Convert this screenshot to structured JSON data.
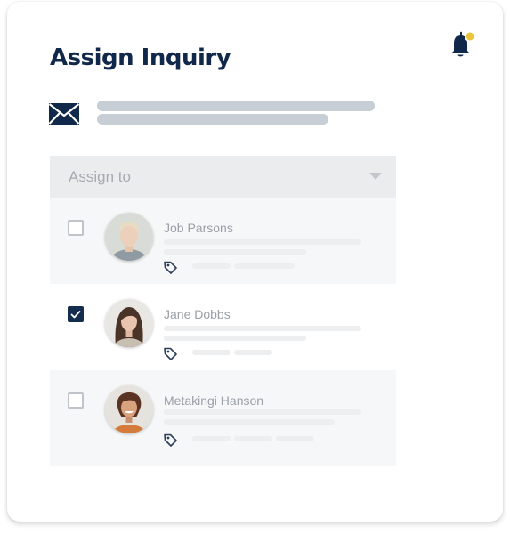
{
  "panel": {
    "title": "Assign Inquiry"
  },
  "icons": {
    "notification": "bell-icon",
    "message": "envelope-icon",
    "dropdown": "chevron-down-icon",
    "tag": "tag-icon",
    "check": "check-icon"
  },
  "colors": {
    "primary": "#10284a",
    "notification_dot": "#e9c33a",
    "placeholder_text": "#a6abb3",
    "skeleton": "#c8ced6"
  },
  "assign": {
    "placeholder": "Assign to"
  },
  "assignees": [
    {
      "name": "Job Parsons",
      "checked": false
    },
    {
      "name": "Jane Dobbs",
      "checked": true
    },
    {
      "name": "Metakingi Hanson",
      "checked": false
    }
  ]
}
